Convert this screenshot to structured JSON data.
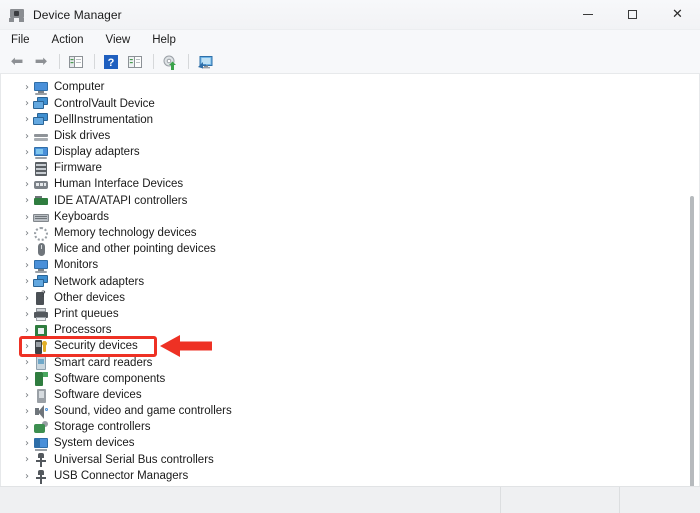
{
  "window": {
    "title": "Device Manager",
    "title_icon": "device-manager-icon",
    "controls": {
      "minimize": "Minimize",
      "maximize": "Maximize",
      "close": "Close"
    }
  },
  "menubar": {
    "items": [
      {
        "label": "File"
      },
      {
        "label": "Action"
      },
      {
        "label": "View"
      },
      {
        "label": "Help"
      }
    ]
  },
  "toolbar": {
    "buttons": [
      {
        "name": "back-button",
        "icon": "left-arrow-icon",
        "glyph": "⬅"
      },
      {
        "name": "forward-button",
        "icon": "right-arrow-icon",
        "glyph": "➡"
      },
      {
        "name": "show-hide-console-tree-button",
        "icon": "console-tree-icon"
      },
      {
        "name": "help-button",
        "icon": "question-mark-icon",
        "glyph": "?"
      },
      {
        "name": "properties-button",
        "icon": "properties-panel-icon"
      },
      {
        "name": "scan-for-hardware-changes-button",
        "icon": "scan-hardware-icon"
      },
      {
        "name": "update-driver-button",
        "icon": "monitor-update-icon"
      }
    ]
  },
  "tree": {
    "items": [
      {
        "label": "Computer",
        "icon": "computer-icon",
        "icon_class": "i-monitor",
        "expander": "›"
      },
      {
        "label": "ControlVault Device",
        "icon": "controlvault-device-icon",
        "icon_class": "i-dualmon",
        "expander": "›"
      },
      {
        "label": "DellInstrumentation",
        "icon": "dell-instrumentation-icon",
        "icon_class": "i-dualmon",
        "expander": "›"
      },
      {
        "label": "Disk drives",
        "icon": "disk-drive-icon",
        "icon_class": "i-disk",
        "expander": "›"
      },
      {
        "label": "Display adapters",
        "icon": "display-adapter-icon",
        "icon_class": "i-display",
        "expander": "›"
      },
      {
        "label": "Firmware",
        "icon": "firmware-icon",
        "icon_class": "i-firmware",
        "expander": "›"
      },
      {
        "label": "Human Interface Devices",
        "icon": "human-interface-device-icon",
        "icon_class": "i-hid",
        "expander": "›"
      },
      {
        "label": "IDE ATA/ATAPI controllers",
        "icon": "ide-controller-icon",
        "icon_class": "i-ide",
        "expander": "›"
      },
      {
        "label": "Keyboards",
        "icon": "keyboard-icon",
        "icon_class": "i-keyboard",
        "expander": "›"
      },
      {
        "label": "Memory technology devices",
        "icon": "memory-technology-icon",
        "icon_class": "i-memtech",
        "expander": "›"
      },
      {
        "label": "Mice and other pointing devices",
        "icon": "mouse-icon",
        "icon_class": "i-mouse",
        "expander": "›"
      },
      {
        "label": "Monitors",
        "icon": "monitor-icon",
        "icon_class": "i-monitor",
        "expander": "›"
      },
      {
        "label": "Network adapters",
        "icon": "network-adapter-icon",
        "icon_class": "i-network",
        "expander": "›"
      },
      {
        "label": "Other devices",
        "icon": "other-device-icon",
        "icon_class": "i-other",
        "expander": "›"
      },
      {
        "label": "Print queues",
        "icon": "printer-icon",
        "icon_class": "i-printer",
        "expander": "›"
      },
      {
        "label": "Processors",
        "icon": "processor-icon",
        "icon_class": "i-proc",
        "expander": "›"
      },
      {
        "label": "Security devices",
        "icon": "security-device-icon",
        "icon_class": "i-sec",
        "expander": "›",
        "highlighted": true
      },
      {
        "label": "Smart card readers",
        "icon": "smart-card-reader-icon",
        "icon_class": "i-smartcard",
        "expander": "›"
      },
      {
        "label": "Software components",
        "icon": "software-component-icon",
        "icon_class": "i-swcomp",
        "expander": "›"
      },
      {
        "label": "Software devices",
        "icon": "software-device-icon",
        "icon_class": "i-swdev",
        "expander": "›"
      },
      {
        "label": "Sound, video and game controllers",
        "icon": "sound-controller-icon",
        "icon_class": "i-sound",
        "expander": "›"
      },
      {
        "label": "Storage controllers",
        "icon": "storage-controller-icon",
        "icon_class": "i-storage",
        "expander": "›"
      },
      {
        "label": "System devices",
        "icon": "system-device-icon",
        "icon_class": "i-system",
        "expander": "›"
      },
      {
        "label": "Universal Serial Bus controllers",
        "icon": "usb-controller-icon",
        "icon_class": "i-usb",
        "expander": "›"
      },
      {
        "label": "USB Connector Managers",
        "icon": "usb-connector-manager-icon",
        "icon_class": "i-usb",
        "expander": "›"
      }
    ]
  },
  "annotation": {
    "highlight_color": "#ee3124",
    "target_label": "Security devices",
    "arrow_direction": "left"
  },
  "scrollbar": {
    "vertical": "vertical-scrollbar"
  },
  "statusbar": {
    "cells": [
      "",
      "",
      ""
    ]
  }
}
